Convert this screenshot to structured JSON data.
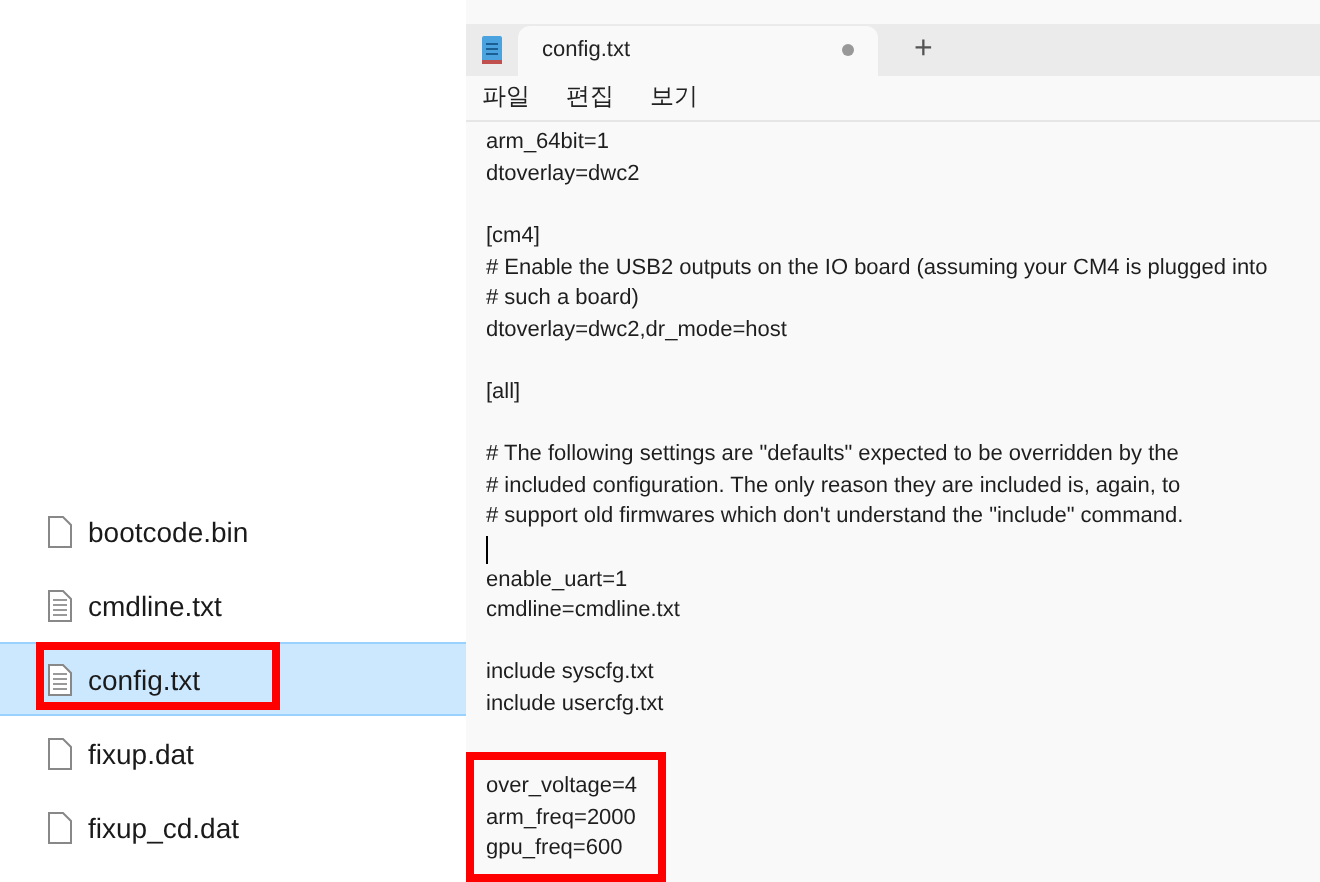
{
  "explorer": {
    "files": [
      {
        "name": "bootcode.bin",
        "kind": "blank",
        "selected": false,
        "highlighted": false
      },
      {
        "name": "cmdline.txt",
        "kind": "text",
        "selected": false,
        "highlighted": false
      },
      {
        "name": "config.txt",
        "kind": "text",
        "selected": true,
        "highlighted": true
      },
      {
        "name": "fixup.dat",
        "kind": "blank",
        "selected": false,
        "highlighted": false
      },
      {
        "name": "fixup_cd.dat",
        "kind": "blank",
        "selected": false,
        "highlighted": false
      }
    ]
  },
  "notepad": {
    "tabs": [
      {
        "title": "config.txt",
        "selected": true,
        "modified": true
      }
    ],
    "new_tab": "+",
    "menu": [
      "파일",
      "편집",
      "보기"
    ],
    "blocks": [
      {
        "lines": [
          {
            "kind": "text",
            "text": "arm_64bit=1"
          },
          {
            "kind": "text",
            "text": "dtoverlay=dwc2"
          },
          {
            "kind": "blank"
          },
          {
            "kind": "text",
            "text": "[cm4]"
          },
          {
            "kind": "text",
            "text": "# Enable the USB2 outputs on the IO board (assuming your CM4 is plugged into"
          },
          {
            "kind": "text",
            "text": "# such a board)"
          },
          {
            "kind": "text",
            "text": "dtoverlay=dwc2,dr_mode=host"
          },
          {
            "kind": "blank"
          },
          {
            "kind": "text",
            "text": "[all]"
          },
          {
            "kind": "blank"
          },
          {
            "kind": "text",
            "text": "# The following settings are \"defaults\" expected to be overridden by the"
          },
          {
            "kind": "text",
            "text": "# included configuration. The only reason they are included is, again, to"
          },
          {
            "kind": "text",
            "text": "# support old firmwares which don't understand the \"include\" command."
          },
          {
            "kind": "caret"
          },
          {
            "kind": "text",
            "text": "enable_uart=1"
          },
          {
            "kind": "text",
            "text": "cmdline=cmdline.txt"
          },
          {
            "kind": "blank"
          },
          {
            "kind": "text",
            "text": "include syscfg.txt"
          },
          {
            "kind": "text",
            "text": "include usercfg.txt"
          },
          {
            "kind": "blank"
          }
        ]
      },
      {
        "highlighted": true,
        "lines": [
          {
            "kind": "text",
            "text": "over_voltage=4"
          },
          {
            "kind": "text",
            "text": "arm_freq=2000"
          },
          {
            "kind": "text",
            "text": "gpu_freq=600"
          }
        ]
      }
    ]
  }
}
